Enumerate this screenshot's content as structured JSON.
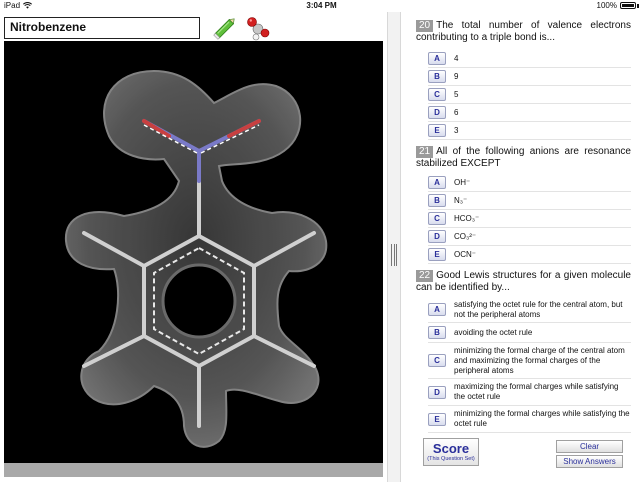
{
  "status_bar": {
    "device": "iPad",
    "time": "3:04 PM",
    "battery": "100%",
    "battery_level": 1.0
  },
  "molecule": {
    "name": "Nitrobenzene"
  },
  "questions": [
    {
      "number": "20",
      "text": "The total number of valence electrons contributing to a triple bond is...",
      "options": [
        {
          "letter": "A",
          "text": "4"
        },
        {
          "letter": "B",
          "text": "9"
        },
        {
          "letter": "C",
          "text": "5"
        },
        {
          "letter": "D",
          "text": "6"
        },
        {
          "letter": "E",
          "text": "3"
        }
      ]
    },
    {
      "number": "21",
      "text": "All of the following anions are resonance stabilized EXCEPT",
      "options": [
        {
          "letter": "A",
          "text": "OH⁻"
        },
        {
          "letter": "B",
          "text": "N₃⁻"
        },
        {
          "letter": "C",
          "text": "HCO₃⁻"
        },
        {
          "letter": "D",
          "text": "CO₃²⁻"
        },
        {
          "letter": "E",
          "text": "OCN⁻"
        }
      ]
    },
    {
      "number": "22",
      "text": "Good Lewis structures for a given molecule can be identified by...",
      "options": [
        {
          "letter": "A",
          "text": "satisfying the octet rule for the central atom, but not the peripheral atoms"
        },
        {
          "letter": "B",
          "text": "avoiding the octet rule"
        },
        {
          "letter": "C",
          "text": "minimizing the formal charge of the central atom and maximizing the formal charges of the peripheral atoms"
        },
        {
          "letter": "D",
          "text": "maximizing the formal charges while satisfying the octet rule"
        },
        {
          "letter": "E",
          "text": "minimizing the formal charges while satisfying the octet rule"
        }
      ]
    }
  ],
  "actions": {
    "score_label": "Score",
    "score_sublabel": "(This Question Set)",
    "clear_label": "Clear",
    "show_answers_label": "Show Answers"
  }
}
